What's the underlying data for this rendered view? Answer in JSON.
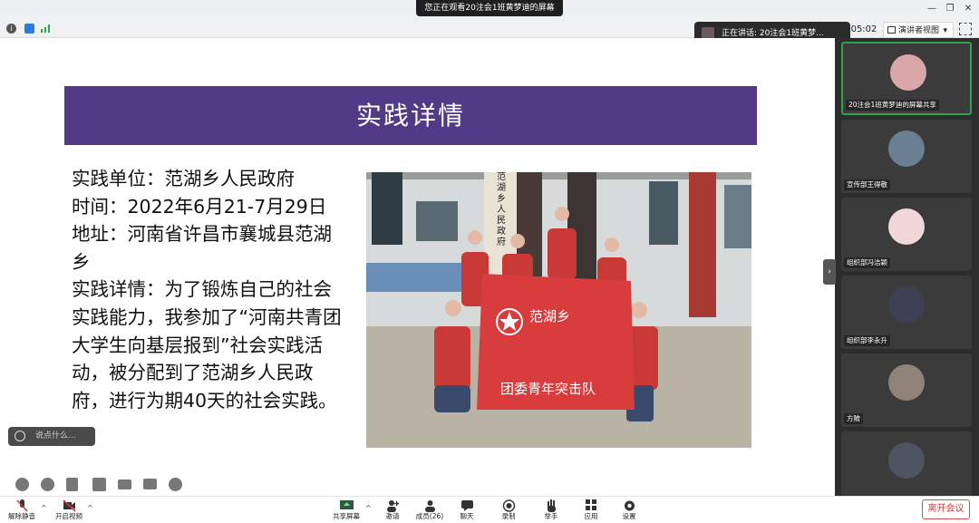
{
  "window": {
    "share_banner": "您正在观看20注会1班黄梦迪的屏幕",
    "minimize": "—",
    "restore": "❐",
    "close": "✕"
  },
  "toolbar": {
    "speaking": "正在讲话: 20注会1班黄梦...",
    "timer": "05:02",
    "view_label": "演讲者视图",
    "view_caret": "▾"
  },
  "slide": {
    "header": "实践详情",
    "lines": [
      "实践单位：范湖乡人民政府",
      "时间：2022年6月21-7月29日",
      "地址：河南省许昌市襄城县范湖乡",
      "实践详情：为了锻炼自己的社会实践能力，我参加了“河南共青团大学生向基层报到”社会实践活动，被分配到了范湖乡人民政府，进行为期40天的社会实践。"
    ],
    "photo": {
      "sign": "范湖乡人民政府",
      "banner_top": "范湖乡",
      "banner_bottom": "团委青年突击队"
    }
  },
  "chat": {
    "placeholder": "说点什么..."
  },
  "participants": [
    {
      "name": "20注会1班黄梦迪的屏幕共享",
      "avatar": "#d9a7a7"
    },
    {
      "name": "宣传部王得敬",
      "avatar": "#6b7f93"
    },
    {
      "name": "组织部冯洁颖",
      "avatar": "#f1d6da"
    },
    {
      "name": "组织部李永升",
      "avatar": "#3e3e55"
    },
    {
      "name": "方陂",
      "avatar": "#8f8378"
    },
    {
      "name": "",
      "avatar": "#4d5560"
    }
  ],
  "controls": {
    "mute": "解除静音",
    "video": "开启视频",
    "share": "共享屏幕",
    "invite": "邀请",
    "members": "成员(26)",
    "chat": "聊天",
    "record": "录制",
    "raise": "举手",
    "apps": "应用",
    "settings": "设置",
    "leave": "离开会议",
    "caret": "^",
    "collapse": "›"
  },
  "colors": {
    "slide_header": "#523a87",
    "leave": "#d83131",
    "active_tile": "#2ea44f",
    "banner_red": "#d93c3c"
  }
}
